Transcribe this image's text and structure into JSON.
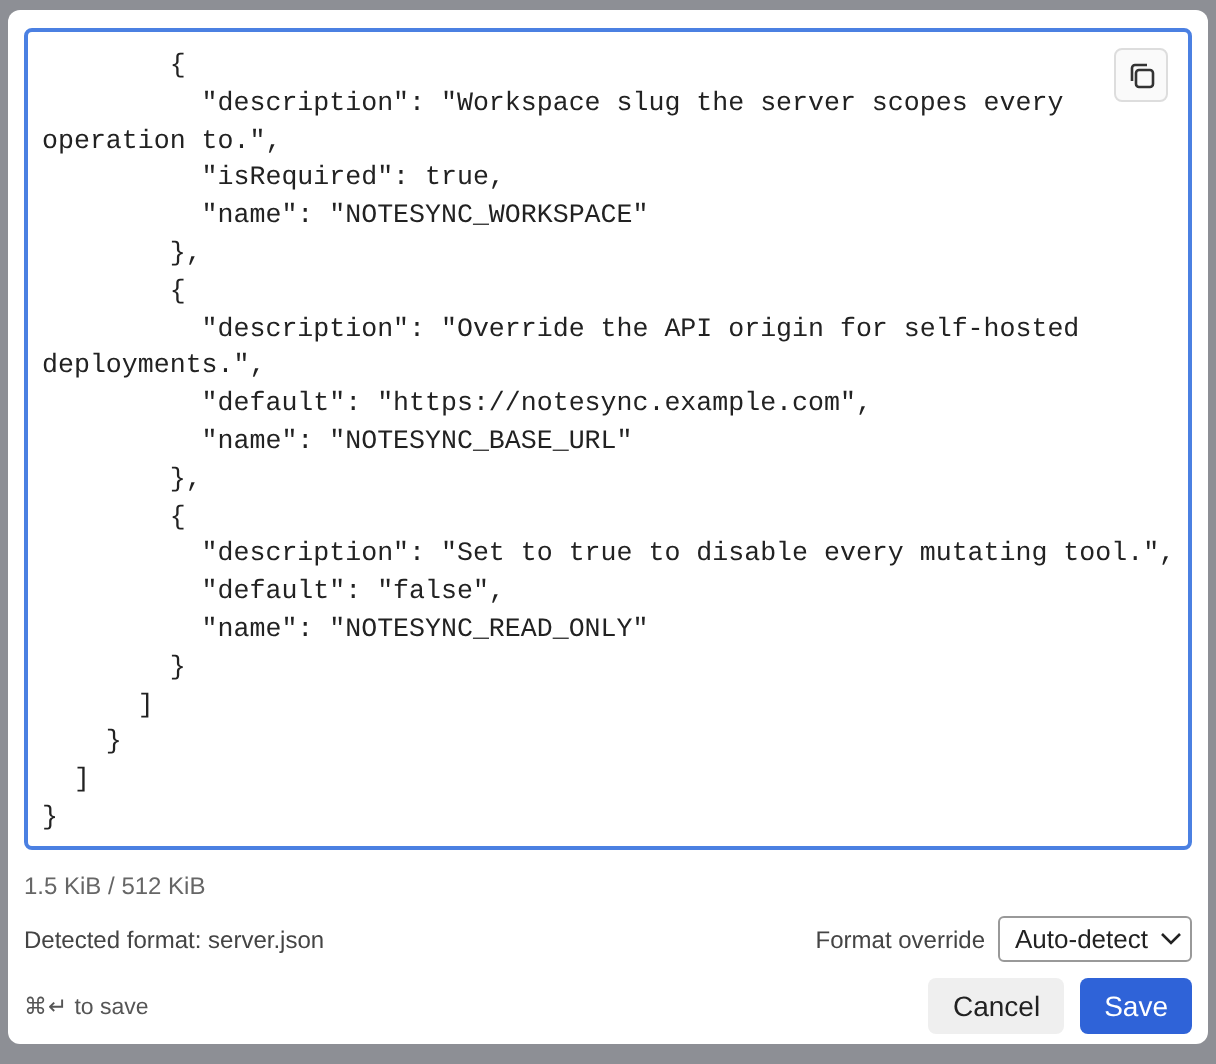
{
  "editor": {
    "lines": [
      "        {",
      "          \"description\": \"Workspace slug the server scopes every",
      "operation to.\",",
      "          \"isRequired\": true,",
      "          \"name\": \"NOTESYNC_WORKSPACE\"",
      "        },",
      "        {",
      "          \"description\": \"Override the API origin for self-hosted",
      "deployments.\",",
      "          \"default\": \"https://notesync.example.com\",",
      "          \"name\": \"NOTESYNC_BASE_URL\"",
      "        },",
      "        {",
      "          \"description\": \"Set to true to disable every mutating tool.\",",
      "          \"default\": \"false\",",
      "          \"name\": \"NOTESYNC_READ_ONLY\"",
      "        }",
      "      ]",
      "    }",
      "  ]",
      "}"
    ]
  },
  "size": "1.5 KiB / 512 KiB",
  "detected_format": "Detected format: server.json",
  "format_override": {
    "label": "Format override",
    "value": "Auto-detect"
  },
  "hint": "⌘↵ to save",
  "buttons": [
    {
      "kind": "secondary",
      "label": "Cancel"
    },
    {
      "kind": "primary",
      "label": "Save"
    }
  ]
}
